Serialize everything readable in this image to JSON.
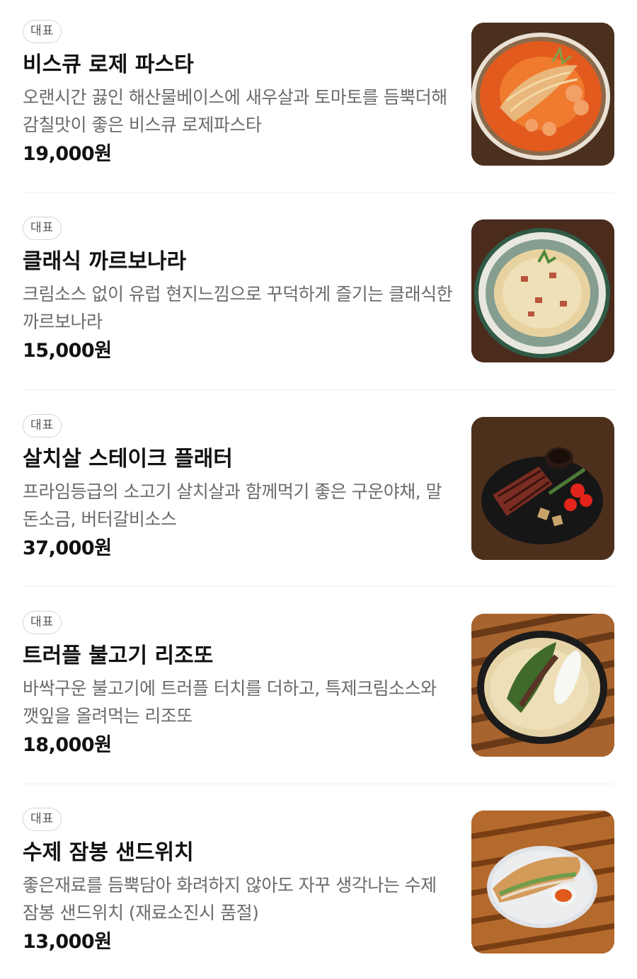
{
  "menu": {
    "items": [
      {
        "badge": "대표",
        "name": "비스큐 로제 파스타",
        "description": "오랜시간 끓인 해산물베이스에 새우살과 토마토를 듬뿍더해 감칠맛이 좋은 비스큐 로제파스타",
        "price": "19,000원",
        "image_icon": "rose-pasta-image"
      },
      {
        "badge": "대표",
        "name": "클래식 까르보나라",
        "description": "크림소스 없이 유럽 현지느낌으로 꾸덕하게 즐기는 클래식한 까르보나라",
        "price": "15,000원",
        "image_icon": "carbonara-image"
      },
      {
        "badge": "대표",
        "name": "살치살 스테이크 플래터",
        "description": "프라임등급의 소고기 살치살과 함께먹기 좋은 구운야채, 말돈소금, 버터갈비소스",
        "price": "37,000원",
        "image_icon": "steak-platter-image"
      },
      {
        "badge": "대표",
        "name": "트러플 불고기 리조또",
        "description": "바싹구운 불고기에 트러플 터치를 더하고, 특제크림소스와 깻잎을 올려먹는 리조또",
        "price": "18,000원",
        "image_icon": "truffle-risotto-image"
      },
      {
        "badge": "대표",
        "name": "수제 잠봉 샌드위치",
        "description": "좋은재료를 듬뿍담아 화려하지 않아도 자꾸 생각나는 수제 잠봉 샌드위치 (재료소진시 품절)",
        "price": "13,000원",
        "image_icon": "jambon-sandwich-image"
      }
    ]
  }
}
